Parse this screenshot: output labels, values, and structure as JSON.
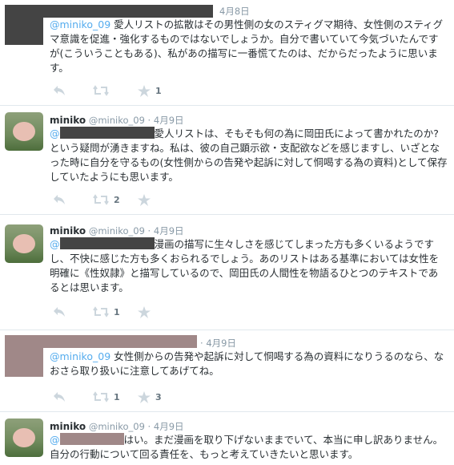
{
  "tweets": [
    {
      "id": "t1",
      "date": "4月8日",
      "mention": "@miniko_09",
      "text": " 愛人リストの拡散はその男性側の女のスティグマ期待、女性側のスティグマ意識を促進・強化するものではないでしょうか。自分で書いていて今気づいたんですが(こういうこともある)、私があの描写に一番慌てたのは、だからだったように思います。",
      "retweets": "",
      "favorites": "1"
    },
    {
      "id": "t2",
      "name": "miniko",
      "handle": "@miniko_09",
      "date": "4月9日",
      "mention_prefix": "@",
      "text": "愛人リストは、そもそも何の為に岡田氏によって書かれたのか?という疑問が湧きますね。私は、彼の自己顕示欲・支配欲などを感じますし、いざとなった時に自分を守るもの(女性側からの告発や起訴に対して恫喝する為の資料)として保存していたようにも思います。",
      "retweets": "2",
      "favorites": ""
    },
    {
      "id": "t3",
      "name": "miniko",
      "handle": "@miniko_09",
      "date": "4月9日",
      "mention_prefix": "@",
      "text": "漫画の描写に生々しさを感じてしまった方も多くいるようですし、不快に感じた方も多くおられるでしょう。あのリストはある基準においては女性を明確に《性奴隷》と描写しているので、岡田氏の人間性を物語るひとつのテキストであるとは思います。",
      "retweets": "1",
      "favorites": ""
    },
    {
      "id": "t4",
      "date": "4月9日",
      "mention": "@miniko_09",
      "text": " 女性側からの告発や起訴に対して恫喝する為の資料になりうるのなら、なおさら取り扱いに注意してあげてね。",
      "retweets": "1",
      "favorites": "3"
    },
    {
      "id": "t5",
      "name": "miniko",
      "handle": "@miniko_09",
      "date": "4月9日",
      "mention_prefix": "@",
      "text": "はい。まだ漫画を取り下げないままでいて、本当に申し訳ありません。自分の行動について回る責任を、もっと考えていきたいと思います。",
      "retweets": "",
      "favorites": ""
    }
  ],
  "icons": {
    "reply": "reply-arrow-icon",
    "retweet": "retweet-icon",
    "favorite": "star-icon"
  },
  "colors": {
    "mention": "#55acee",
    "name": "#292f33",
    "meta": "#8899a6",
    "action": "#aab8c2"
  }
}
